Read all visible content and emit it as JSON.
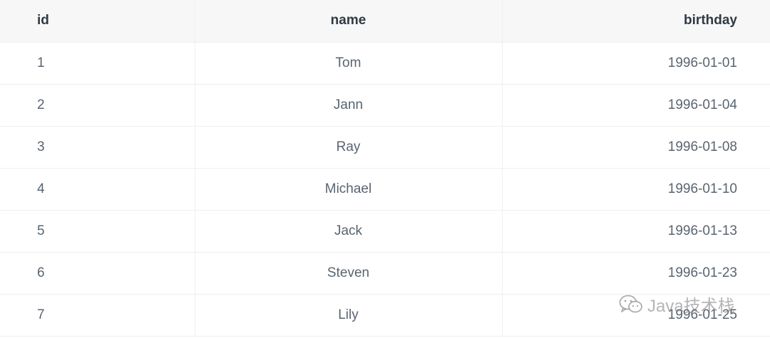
{
  "table": {
    "headers": {
      "id": "id",
      "name": "name",
      "birthday": "birthday"
    },
    "rows": [
      {
        "id": "1",
        "name": "Tom",
        "birthday": "1996-01-01"
      },
      {
        "id": "2",
        "name": "Jann",
        "birthday": "1996-01-04"
      },
      {
        "id": "3",
        "name": "Ray",
        "birthday": "1996-01-08"
      },
      {
        "id": "4",
        "name": "Michael",
        "birthday": "1996-01-10"
      },
      {
        "id": "5",
        "name": "Jack",
        "birthday": "1996-01-13"
      },
      {
        "id": "6",
        "name": "Steven",
        "birthday": "1996-01-23"
      },
      {
        "id": "7",
        "name": "Lily",
        "birthday": "1996-01-25"
      }
    ]
  },
  "watermark": {
    "text": "Java技术栈",
    "icon": "wechat-icon"
  }
}
